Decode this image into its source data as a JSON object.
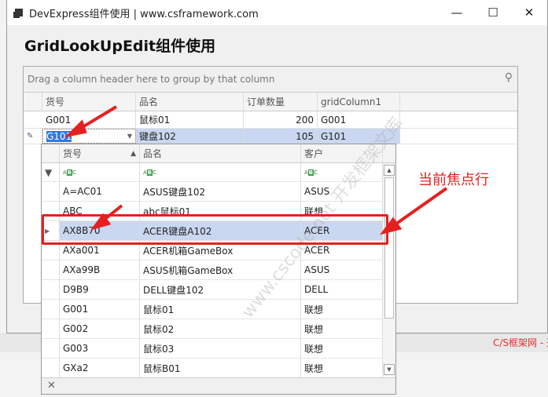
{
  "window": {
    "title": "DevExpress组件使用 | www.csframework.com",
    "heading": "GridLookUpEdit组件使用"
  },
  "grid": {
    "group_panel": "Drag a column header here to group by that column",
    "columns": [
      "货号",
      "品名",
      "订单数量",
      "gridColumn1"
    ],
    "rows": [
      [
        "G001",
        "鼠标01",
        "200",
        "G001"
      ],
      [
        "G101",
        "键盘102",
        "105",
        "G101"
      ]
    ]
  },
  "popup": {
    "columns": [
      "货号",
      "品名",
      "客户"
    ],
    "rows": [
      [
        "A=AC01",
        "ASUS键盘102",
        "ASUS"
      ],
      [
        "ABC",
        "abc鼠标01",
        "联想"
      ],
      [
        "AX8B70",
        "ACER键盘A102",
        "ACER"
      ],
      [
        "AXa001",
        "ACER机箱GameBox",
        "ACER"
      ],
      [
        "AXa99B",
        "ASUS机箱GameBox",
        "ASUS"
      ],
      [
        "D9B9",
        "DELL键盘102",
        "DELL"
      ],
      [
        "G001",
        "鼠标01",
        "联想"
      ],
      [
        "G002",
        "鼠标02",
        "联想"
      ],
      [
        "G003",
        "鼠标03",
        "联想"
      ],
      [
        "GXa2",
        "鼠标B01",
        "联想"
      ]
    ],
    "selected_index": 2
  },
  "annotation": {
    "label": "当前焦点行",
    "color": "#e62020"
  },
  "watermark": "www.cscode.net 开发框架文库",
  "background_text": "C/S框架网 - 开"
}
